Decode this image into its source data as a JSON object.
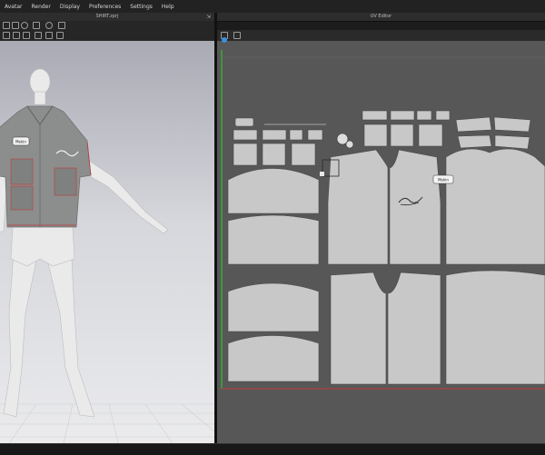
{
  "menubar": {
    "items": [
      "Avatar",
      "Render",
      "Display",
      "Preferences",
      "Settings",
      "Help"
    ]
  },
  "viewport": {
    "title": "SHIRT.zprj",
    "expand_glyph": "⇲"
  },
  "uv_editor": {
    "title": "UV Editor"
  },
  "graphic": {
    "logo_text": "Mekin"
  },
  "colors": {
    "uv_background": "#575757",
    "uv_pattern_fill": "#c8c8c8",
    "viewport_background": "#d0d1d6",
    "shirt_fabric": "#8c8e8d",
    "accent_green": "#2fbf2f",
    "accent_red": "#c03a3a",
    "selection_blue": "#3b8fe0"
  },
  "icons": {
    "viewport_toolbar": [
      "select-icon",
      "move-icon",
      "rotate-icon",
      "scale-icon",
      "avatar-icon",
      "camera-icon",
      "view-icon",
      "light-icon",
      "grid-icon"
    ],
    "uv_toolbar": [
      "uv-transform-icon",
      "uv-edit-icon"
    ]
  }
}
